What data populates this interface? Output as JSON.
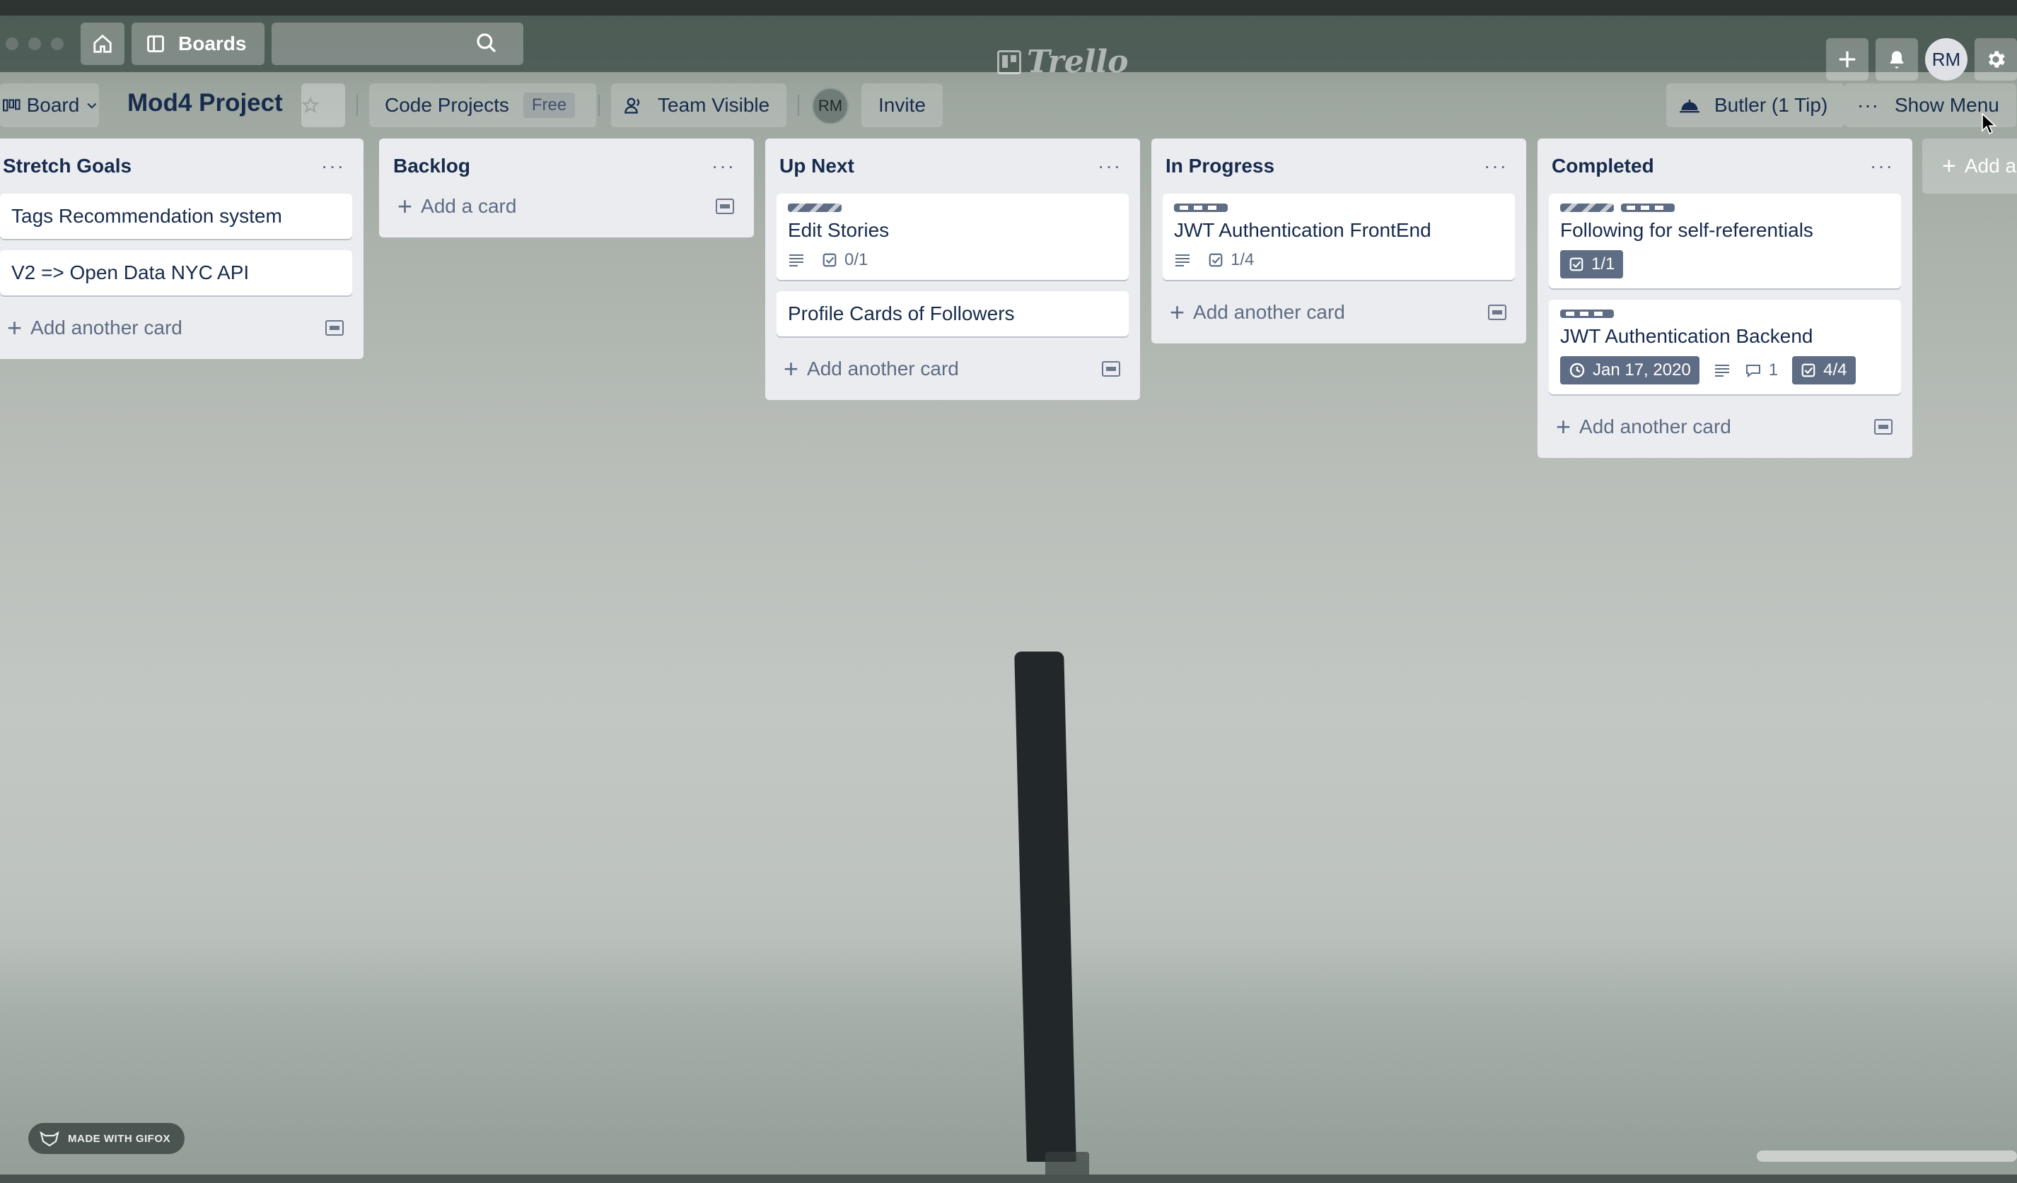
{
  "header": {
    "boards_label": "Boards",
    "search_value": "",
    "logo_text": "Trello",
    "avatar_initials": "RM"
  },
  "board": {
    "view_label": "Board",
    "title": "Mod4 Project",
    "team_name": "Code Projects",
    "team_badge": "Free",
    "visibility": "Team Visible",
    "member_initials": "RM",
    "invite_label": "Invite",
    "butler_label": "Butler (1 Tip)",
    "menu_label": "Show Menu"
  },
  "lists": [
    {
      "title": "Stretch Goals",
      "cards": [
        {
          "title": "Tags Recommendation system"
        },
        {
          "title": "V2 => Open Data NYC API"
        }
      ],
      "add_label": "Add another card"
    },
    {
      "title": "Backlog",
      "cards": [],
      "add_label": "Add a card"
    },
    {
      "title": "Up Next",
      "cards": [
        {
          "title": "Edit Stories",
          "checklist": "0/1"
        },
        {
          "title": "Profile Cards of Followers"
        }
      ],
      "add_label": "Add another card"
    },
    {
      "title": "In Progress",
      "cards": [
        {
          "title": "JWT Authentication FrontEnd",
          "checklist": "1/4"
        }
      ],
      "add_label": "Add another card"
    },
    {
      "title": "Completed",
      "cards": [
        {
          "title": "Following for self-referentials",
          "checklist": "1/1"
        },
        {
          "title": "JWT Authentication Backend",
          "due": "Jan 17, 2020",
          "comments": "1",
          "checklist": "4/4"
        }
      ],
      "add_label": "Add another card"
    }
  ],
  "add_list_label": "Add a",
  "watermark": "MADE WITH GIFOX",
  "colors": {
    "header_bg": "#4a5852",
    "list_bg": "#ebecf0",
    "text": "#172b4d",
    "muted": "#5e6c84"
  }
}
